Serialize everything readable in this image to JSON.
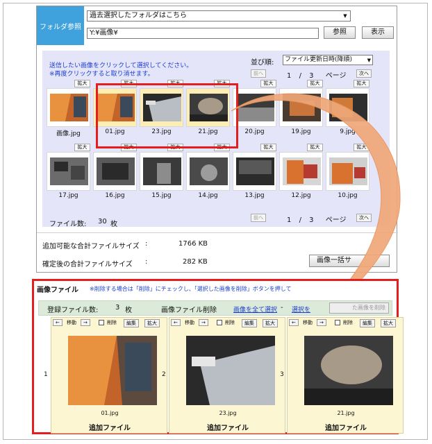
{
  "folder": {
    "label": "フォルダ参照",
    "history_value": "過去選択したフォルダはこちら",
    "path_value": "Y:¥画像¥",
    "browse_button": "参照",
    "display_button": "表示"
  },
  "gallery": {
    "instruction_1": "送信したい画像をクリックして選択してください。",
    "instruction_2": "※再度クリックすると取り消せます。",
    "sort_label": "並び順:",
    "sort_value": "ファイル更新日時(降順)",
    "prev_label": "前へ",
    "next_label": "次へ",
    "page_current": "1",
    "page_sep": "/",
    "page_total": "3",
    "page_unit": "ページ",
    "zoom_label": "拡大",
    "row1": [
      {
        "name": "画像.jpg",
        "selected": false
      },
      {
        "name": "01.jpg",
        "selected": true
      },
      {
        "name": "23.jpg",
        "selected": true
      },
      {
        "name": "21.jpg",
        "selected": true
      },
      {
        "name": "20.jpg",
        "selected": false
      },
      {
        "name": "19.jpg",
        "selected": false
      },
      {
        "name": "9.jpg",
        "selected": false
      }
    ],
    "row2": [
      {
        "name": "17.jpg"
      },
      {
        "name": "16.jpg"
      },
      {
        "name": "15.jpg"
      },
      {
        "name": "14.jpg"
      },
      {
        "name": "13.jpg"
      },
      {
        "name": "12.jpg"
      },
      {
        "name": "10.jpg"
      }
    ],
    "file_count_label": "ファイル数:",
    "file_count_value": "30",
    "file_count_unit": "枚"
  },
  "sizes": {
    "addable_label": "追加可能な合計ファイルサイズ",
    "addable_colon": ":",
    "addable_value": "1766 KB",
    "confirmed_label": "確定後の合計ファイルサイズ",
    "confirmed_colon": ":",
    "confirmed_value": "282 KB",
    "bulk_button": "画像一括サ"
  },
  "image_files": {
    "title": "画像ファイル",
    "note": "※削除する場合は「削除」にチェックし、「選択した画像を削除」ボタンを押して",
    "registered_label": "登録ファイル数:",
    "registered_value": "3",
    "registered_unit": "枚",
    "delete_section_label": "画像ファイル削除",
    "select_all_link": "画像を全て選択",
    "dash": "-",
    "deselect_link": "選択を",
    "delete_selected_button": "た画像を削除",
    "move_left": "←",
    "move_label": "移動",
    "move_right": "→",
    "delete_check_label": "削除",
    "edit_label": "編集",
    "zoom_label": "拡大",
    "cards": [
      {
        "index": "1",
        "file": "01.jpg",
        "status": "追加ファイル"
      },
      {
        "index": "2",
        "file": "23.jpg",
        "status": "追加ファイル"
      },
      {
        "index": "3",
        "file": "21.jpg",
        "status": "追加ファイル"
      }
    ]
  },
  "colors": {
    "accent_blue": "#3fa2dc",
    "highlight_red": "#e41d1d",
    "arrow_orange": "#f0a878",
    "gallery_bg": "#e5e5f9",
    "card_bg": "#fdf6d3"
  }
}
